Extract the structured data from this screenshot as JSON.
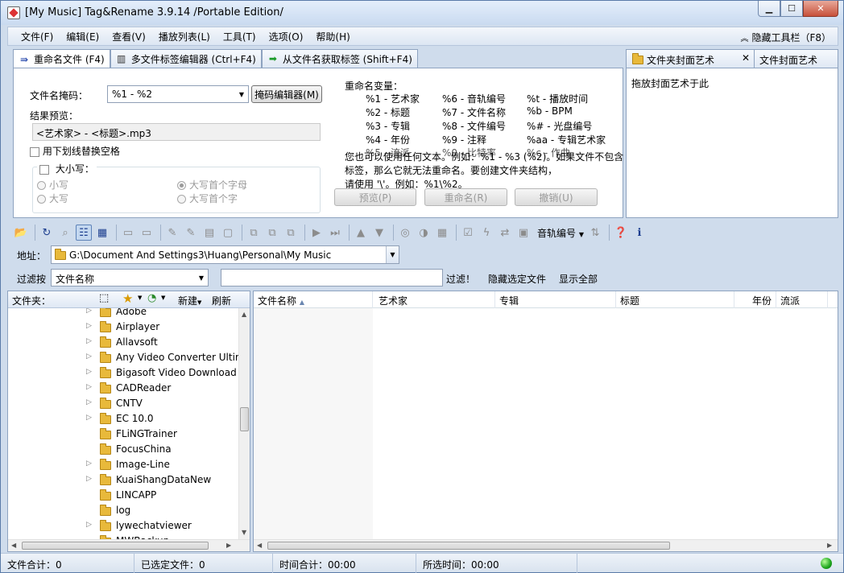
{
  "window": {
    "title": "[My Music] Tag&Rename 3.9.14 /Portable Edition/"
  },
  "menu": {
    "items": [
      "文件(F)",
      "编辑(E)",
      "查看(V)",
      "播放列表(L)",
      "工具(T)",
      "选项(O)",
      "帮助(H)"
    ],
    "hide_toolbar": "隐藏工具栏（F8）"
  },
  "tabs": [
    {
      "label": "重命名文件 (F4)"
    },
    {
      "label": "多文件标签编辑器 (Ctrl+F4)"
    },
    {
      "label": "从文件名获取标签 (Shift+F4)"
    }
  ],
  "rename": {
    "mask_label": "文件名掩码：",
    "mask_value": "%1 - %2",
    "mask_editor_button": "掩码编辑器(M)",
    "preview_label": "结果预览：",
    "preview_value": "<艺术家> - <标题>.mp3",
    "underscore_option": "用下划线替换空格",
    "case_group_label": "大小写：",
    "case_options": [
      "小写",
      "大写首个字母",
      "大写",
      "大写首个字"
    ],
    "variables_title": "重命名变量：",
    "variables": [
      "%1 - 艺术家",
      "%6 - 音轨编号",
      "%t - 播放时间",
      "%2 - 标题",
      "%7 - 文件名称",
      "%b - BPM",
      "%3 - 专辑",
      "%8 - 文件编号",
      "%# - 光盘编号",
      "%4 - 年份",
      "%9 - 注释",
      "%aa - 专辑艺术家",
      "%5 - 流派",
      "%0 - 比特率",
      "%c - 作曲"
    ],
    "help_lines": [
      "您也可以使用任何文本。例如：%1 - %3 (%2)。如果文件不包含",
      "标签，那么它就无法重命名。要创建文件夹结构，",
      "请使用 '\\'。例如：%1\\%2。"
    ],
    "preview_button": "预览(P)",
    "rename_button": "重命名(R)",
    "undo_button": "撤销(U)"
  },
  "cover": {
    "header": "文件夹封面艺术",
    "header2": "文件封面艺术",
    "drop_hint": "拖放封面艺术于此"
  },
  "toolbar": {
    "track_label": "音轨编号"
  },
  "address": {
    "label": "地址：",
    "path": "G:\\Document And Settings3\\Huang\\Personal\\My Music"
  },
  "filter": {
    "label": "过滤按",
    "field": "文件名称",
    "apply": "过滤！",
    "hide_selected": "隐藏选定文件",
    "show_all": "显示全部"
  },
  "folders": {
    "header": "文件夹：",
    "new_label": "新建",
    "refresh_label": "刷新",
    "items": [
      {
        "name": "Adobe",
        "expandable": true
      },
      {
        "name": "Airplayer",
        "expandable": true
      },
      {
        "name": "Allavsoft",
        "expandable": true
      },
      {
        "name": "Any Video Converter Ultim",
        "expandable": true
      },
      {
        "name": "Bigasoft Video Download",
        "expandable": true
      },
      {
        "name": "CADReader",
        "expandable": true
      },
      {
        "name": "CNTV",
        "expandable": true
      },
      {
        "name": "EC 10.0",
        "expandable": true
      },
      {
        "name": "FLiNGTrainer",
        "expandable": false
      },
      {
        "name": "FocusChina",
        "expandable": false
      },
      {
        "name": "Image-Line",
        "expandable": true
      },
      {
        "name": "KuaiShangDataNew",
        "expandable": true
      },
      {
        "name": "LINCAPP",
        "expandable": false
      },
      {
        "name": "log",
        "expandable": false
      },
      {
        "name": "lywechatviewer",
        "expandable": true
      },
      {
        "name": "MWBackup",
        "expandable": false
      }
    ]
  },
  "files": {
    "columns": [
      "文件名称",
      "艺术家",
      "专辑",
      "标题",
      "年份",
      "流派"
    ]
  },
  "status": {
    "total_files": "文件合计：0",
    "selected_files": "已选定文件：0",
    "total_time": "时间合计：00:00",
    "selected_time": "所选时间：00:00"
  }
}
